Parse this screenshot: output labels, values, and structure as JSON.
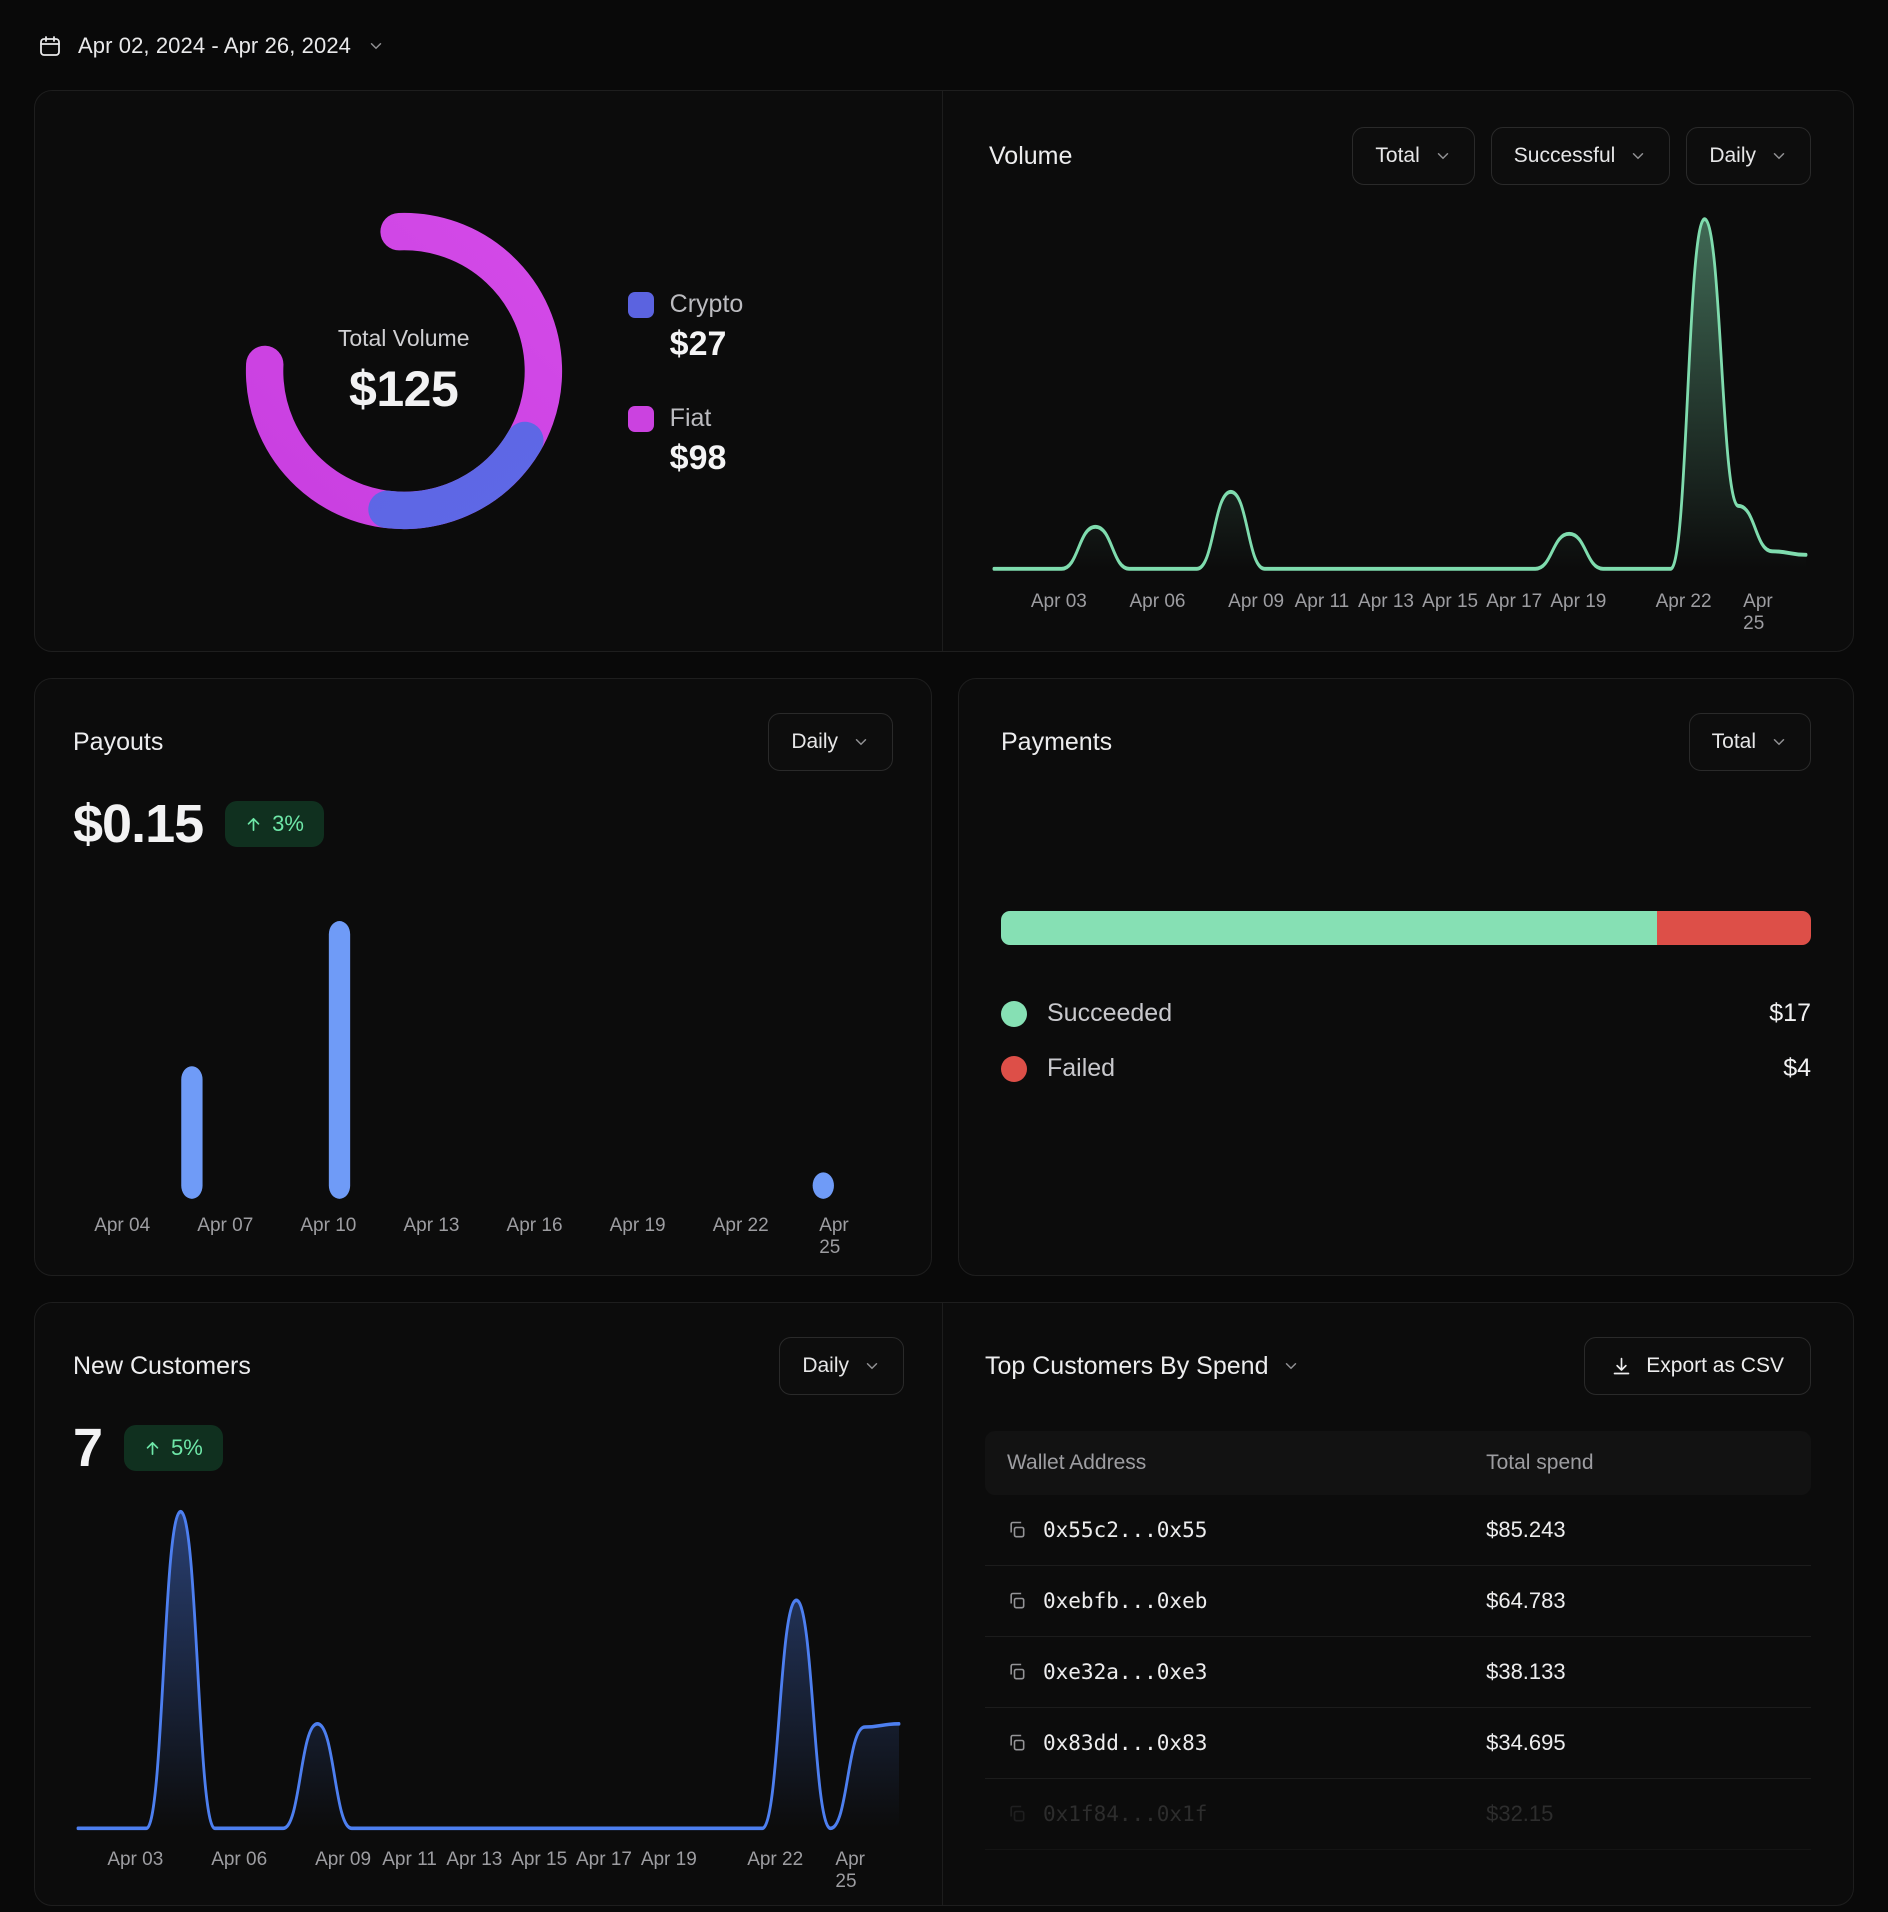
{
  "header": {
    "date_range": "Apr 02, 2024 - Apr 26, 2024",
    "calendar_icon": "calendar-icon",
    "chevron_icon": "chevron-down-icon"
  },
  "volume_card": {
    "donut": {
      "center_label": "Total Volume",
      "center_value": "$125"
    },
    "legend": [
      {
        "name": "Crypto",
        "value": "$27",
        "color": "#5b63e0"
      },
      {
        "name": "Fiat",
        "value": "$98",
        "color": "#cb42e0"
      }
    ],
    "chart_title": "Volume",
    "selects": [
      {
        "label": "Total",
        "name": "volume-total-select"
      },
      {
        "label": "Successful",
        "name": "volume-status-select"
      },
      {
        "label": "Daily",
        "name": "volume-interval-select"
      }
    ]
  },
  "payouts_card": {
    "title": "Payouts",
    "select": "Daily",
    "value": "$0.15",
    "delta": "3%",
    "delta_direction": "up"
  },
  "payments_card": {
    "title": "Payments",
    "select": "Total",
    "rows": [
      {
        "name": "Succeeded",
        "amount": "$17",
        "color": "#86e0b4"
      },
      {
        "name": "Failed",
        "amount": "$4",
        "color": "#dd4f48"
      }
    ]
  },
  "customers_card": {
    "title": "New Customers",
    "select": "Daily",
    "value": "7",
    "delta": "5%",
    "delta_direction": "up"
  },
  "table_card": {
    "title": "Top Customers By Spend",
    "title_chevron": "chevron-down-icon",
    "export_label": "Export as CSV",
    "export_icon": "download-icon",
    "columns": [
      "Wallet Address",
      "Total spend"
    ],
    "rows": [
      {
        "address": "0x55c2...0x55",
        "spend": "$85.243"
      },
      {
        "address": "0xebfb...0xeb",
        "spend": "$64.783"
      },
      {
        "address": "0xe32a...0xe3",
        "spend": "$38.133"
      },
      {
        "address": "0x83dd...0x83",
        "spend": "$34.695"
      },
      {
        "address": "0x1f84...0x1f",
        "spend": "$32.15"
      }
    ]
  },
  "chart_data": [
    {
      "id": "volume_donut",
      "type": "pie",
      "title": "Total Volume",
      "total": 125,
      "categories": [
        "Fiat",
        "Crypto"
      ],
      "values": [
        98,
        27
      ],
      "colors": [
        "#cb42e0",
        "#5b63e0"
      ],
      "legend": "right"
    },
    {
      "id": "volume_line",
      "type": "area",
      "title": "Volume",
      "xlabel": "",
      "ylabel": "",
      "grid": false,
      "color": "#7fdcae",
      "tick_labels": [
        "Apr 03",
        "Apr 06",
        "Apr 09",
        "Apr 11",
        "Apr 13",
        "Apr 15",
        "Apr 17",
        "Apr 19",
        "Apr 22",
        "Apr 25"
      ],
      "tick_positions": [
        0.085,
        0.205,
        0.325,
        0.405,
        0.483,
        0.561,
        0.639,
        0.717,
        0.845,
        0.945
      ],
      "x": [
        "Apr 02",
        "Apr 03",
        "Apr 04",
        "Apr 05",
        "Apr 06",
        "Apr 07",
        "Apr 08",
        "Apr 09",
        "Apr 10",
        "Apr 11",
        "Apr 12",
        "Apr 13",
        "Apr 14",
        "Apr 15",
        "Apr 16",
        "Apr 17",
        "Apr 18",
        "Apr 19",
        "Apr 20",
        "Apr 21",
        "Apr 22",
        "Apr 23",
        "Apr 24",
        "Apr 25",
        "Apr 26"
      ],
      "values": [
        0,
        0,
        0,
        0.12,
        0,
        0,
        0,
        0.22,
        0,
        0,
        0,
        0,
        0,
        0,
        0,
        0,
        0,
        0.1,
        0,
        0,
        0,
        1.0,
        0.18,
        0.05,
        0.04
      ],
      "ylim": [
        0,
        1
      ]
    },
    {
      "id": "payouts_bar",
      "type": "bar",
      "title": "Payouts",
      "xlabel": "",
      "ylabel": "",
      "grid": false,
      "color": "#6f9bf7",
      "tick_labels": [
        "Apr 04",
        "Apr 07",
        "Apr 10",
        "Apr 13",
        "Apr 16",
        "Apr 19",
        "Apr 22",
        "Apr 25"
      ],
      "categories": [
        "Apr 05",
        "Apr 09",
        "Apr 25"
      ],
      "bar_positions": [
        0.145,
        0.325,
        0.915
      ],
      "values": [
        0.42,
        0.88,
        0.03
      ],
      "ylim": [
        0,
        1
      ]
    },
    {
      "id": "payments_stacked",
      "type": "bar",
      "title": "Payments",
      "orientation": "horizontal-stacked",
      "categories": [
        "Succeeded",
        "Failed"
      ],
      "values": [
        17,
        4
      ],
      "percentages": [
        81,
        19
      ],
      "colors": [
        "#86e0b4",
        "#dd4f48"
      ]
    },
    {
      "id": "new_customers_line",
      "type": "area",
      "title": "New Customers",
      "xlabel": "",
      "ylabel": "",
      "grid": false,
      "color": "#4d7ff0",
      "tick_labels": [
        "Apr 03",
        "Apr 06",
        "Apr 09",
        "Apr 11",
        "Apr 13",
        "Apr 15",
        "Apr 17",
        "Apr 19",
        "Apr 22",
        "Apr 25"
      ],
      "tick_positions": [
        0.075,
        0.2,
        0.325,
        0.405,
        0.483,
        0.561,
        0.639,
        0.717,
        0.845,
        0.945
      ],
      "x": [
        "Apr 02",
        "Apr 03",
        "Apr 04",
        "Apr 05",
        "Apr 06",
        "Apr 07",
        "Apr 08",
        "Apr 09",
        "Apr 10",
        "Apr 11",
        "Apr 12",
        "Apr 13",
        "Apr 14",
        "Apr 15",
        "Apr 16",
        "Apr 17",
        "Apr 18",
        "Apr 19",
        "Apr 20",
        "Apr 21",
        "Apr 22",
        "Apr 23",
        "Apr 24",
        "Apr 25",
        "Apr 26"
      ],
      "values": [
        0,
        0,
        0,
        1.0,
        0,
        0,
        0,
        0.33,
        0,
        0,
        0,
        0,
        0,
        0,
        0,
        0,
        0,
        0,
        0,
        0,
        0,
        0.72,
        0,
        0.32,
        0.33
      ],
      "ylim": [
        0,
        1
      ]
    }
  ]
}
